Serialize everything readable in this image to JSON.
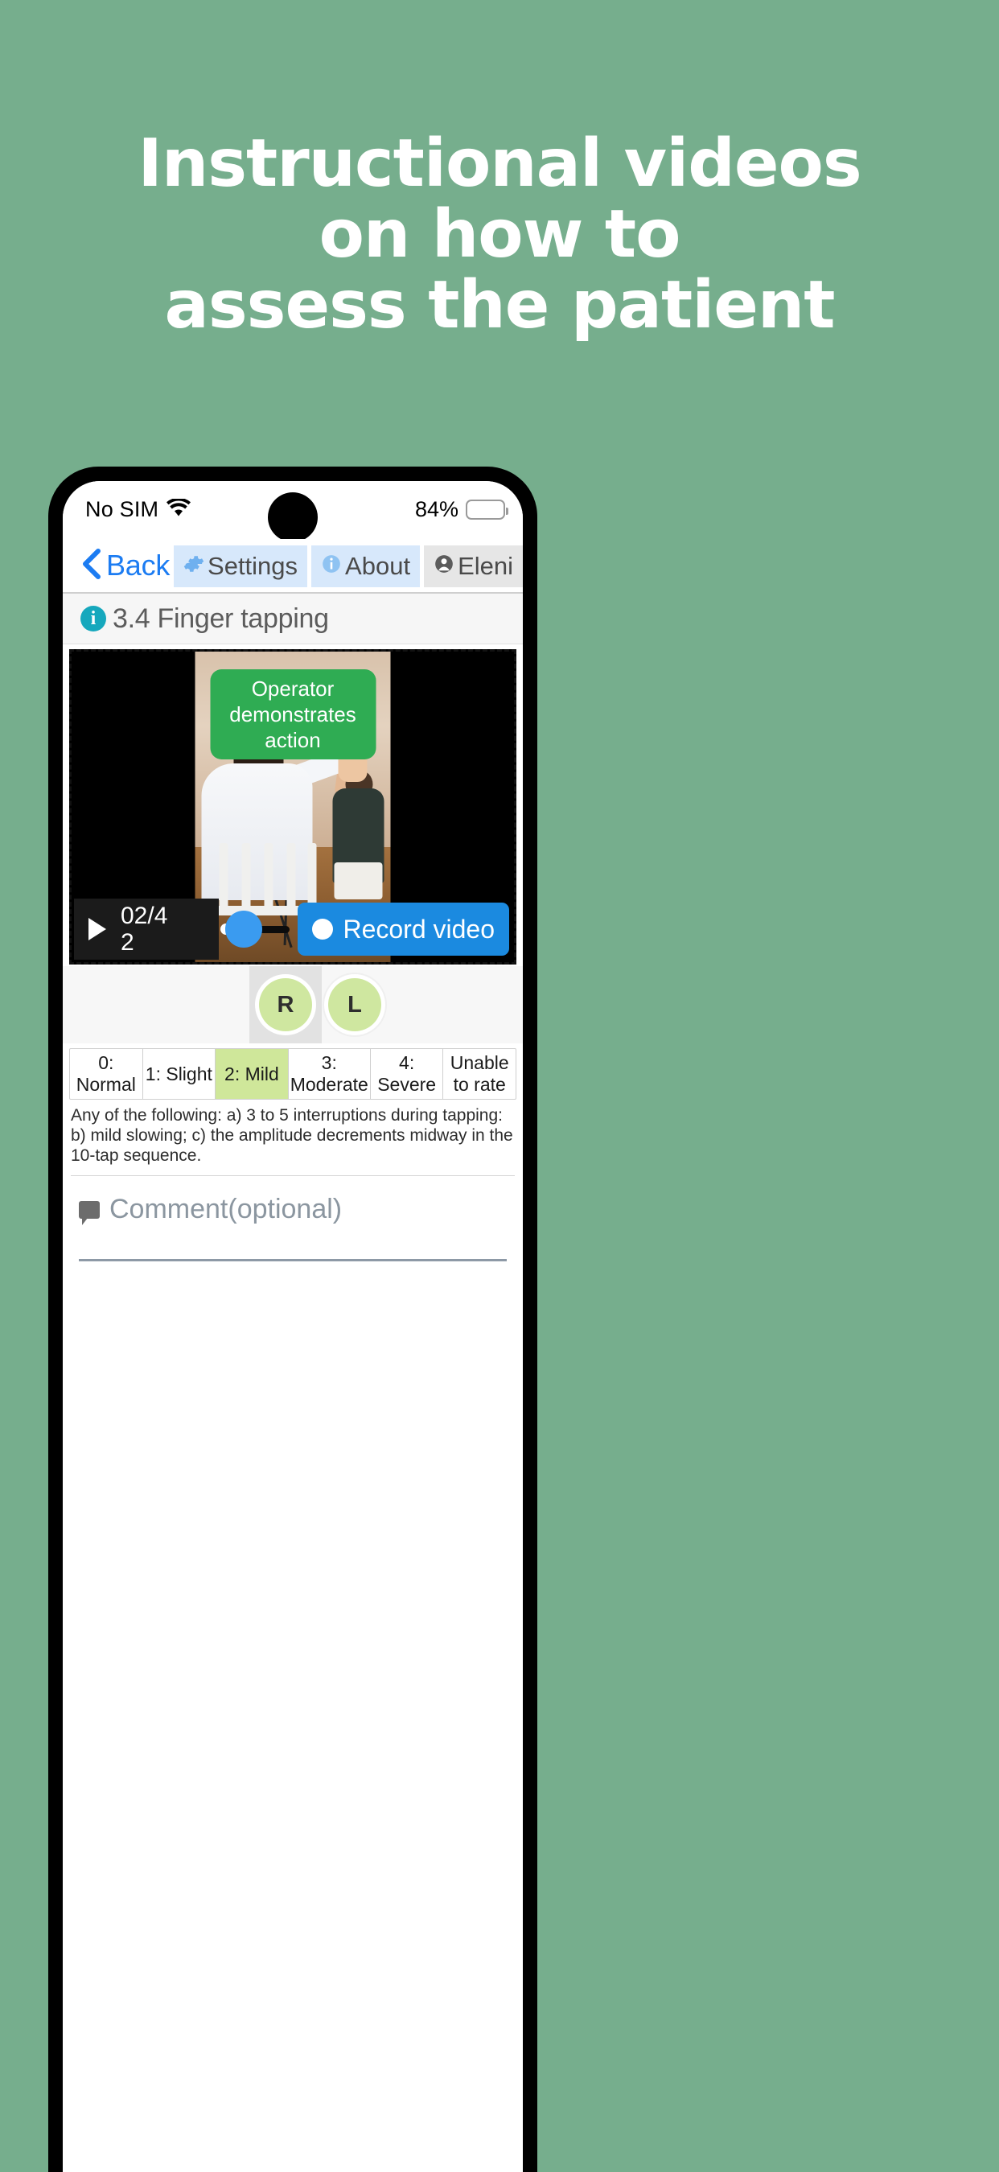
{
  "promo": {
    "background_color": "#76ae8d",
    "headline_lines": [
      "Instructional videos",
      "on how to",
      "assess the patient"
    ]
  },
  "status_bar": {
    "carrier": "No SIM",
    "wifi_icon": "wifi-icon",
    "battery_percent": "84%",
    "battery_icon": "battery-icon"
  },
  "navbar": {
    "back_label": "Back",
    "back_chevron_icon": "chevron-left-icon",
    "menu_icon": "hamburger-menu-icon",
    "chips": [
      {
        "label": "Settings",
        "icon": "gear-icon",
        "style": "blue"
      },
      {
        "label": "About",
        "icon": "info-circle-icon",
        "style": "blue"
      },
      {
        "label": "Eleni",
        "icon": "user-circle-icon",
        "style": "grey"
      }
    ]
  },
  "section": {
    "info_icon": "info-badge-icon",
    "info_glyph": "i",
    "title": "3.4 Finger tapping"
  },
  "video": {
    "banner_text": "Operator demonstrates action",
    "banner_color": "#2fac53",
    "play_icon": "play-icon",
    "time_label": "02/42",
    "scrub_icon": "scrubber-knob",
    "record_button_label": "Record video",
    "record_dot_icon": "record-dot-icon",
    "record_button_color": "#1b8ae0"
  },
  "side_selector": {
    "options": [
      {
        "label": "R",
        "selected": true
      },
      {
        "label": "L",
        "selected": false
      }
    ],
    "circle_color": "#cfe7a0"
  },
  "rating_scale": {
    "selected_index": 2,
    "selected_color": "#cfe79a",
    "options": [
      "0: Normal",
      "1: Slight",
      "2: Mild",
      "3: Moderate",
      "4: Severe",
      "Unable to rate"
    ],
    "description": "Any of the following: a) 3 to 5 interruptions during tapping: b) mild slowing; c) the amplitude decrements midway in the 10-tap sequence."
  },
  "comment": {
    "icon": "comment-bubble-icon",
    "label": "Comment(optional)",
    "value": ""
  }
}
